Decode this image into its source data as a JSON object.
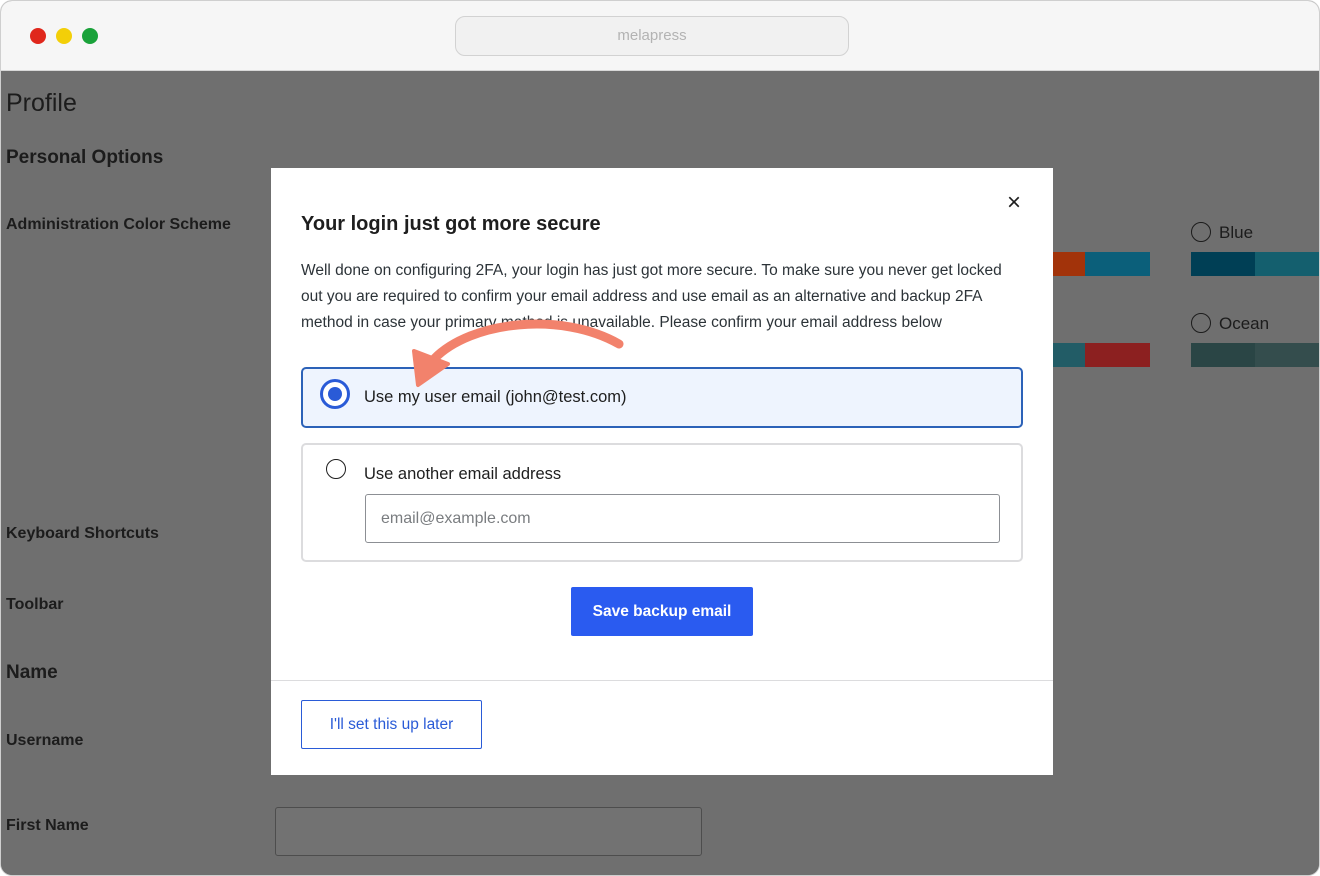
{
  "browser": {
    "url": "melapress"
  },
  "profile_page": {
    "title": "Profile",
    "personal_options": "Personal Options",
    "color_scheme_label": "Administration Color Scheme",
    "keyboard_shortcuts_label": "Keyboard Shortcuts",
    "toolbar_label": "Toolbar",
    "name_heading": "Name",
    "username_label": "Username",
    "first_name_label": "First Name",
    "color_schemes": [
      {
        "label": "Blue",
        "swatches": [
          "#003f55",
          "#145f6e",
          "#1a6a7a"
        ]
      },
      {
        "label": "Ocean",
        "swatches": [
          "#2a4545",
          "#344d4d",
          "#3a5353"
        ]
      }
    ],
    "partial_swatches": [
      "#a2330a",
      "#0b5f7a",
      "#225c66",
      "#8c2020"
    ]
  },
  "modal": {
    "close_icon": "×",
    "title": "Your login just got more secure",
    "body": "Well done on configuring 2FA, your login has just got more secure. To make sure you never get locked out you are required to confirm your email address and use email as an alternative and backup 2FA method in case your primary method is unavailable. Please confirm your email address below",
    "option_user_email": "Use my user email (john@test.com)",
    "option_user_email_selected": true,
    "option_other_email": "Use another email address",
    "email_placeholder": "email@example.com",
    "save_button": "Save backup email",
    "later_button": "I'll set this up later",
    "accent_color": "#2a5bf0",
    "annotation_arrow_color": "#f2826c"
  }
}
